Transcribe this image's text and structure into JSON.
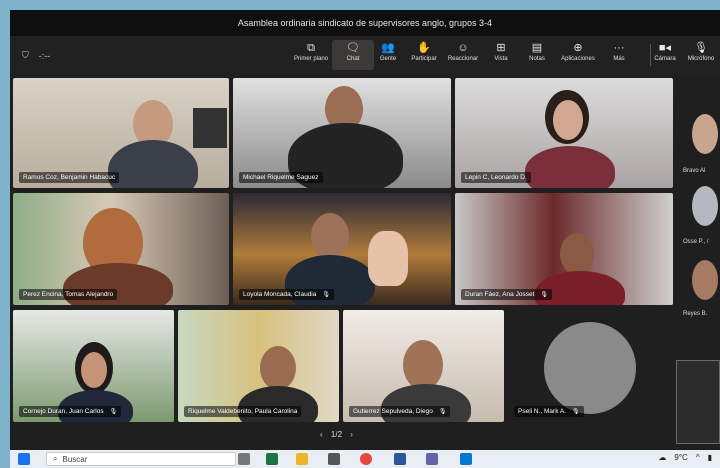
{
  "window": {
    "title": "Asamblea ordinaria sindicato de supervisores anglo, grupos 3-4"
  },
  "toolbar": {
    "timer": "-:--",
    "buttons": [
      {
        "label": "Primer plano",
        "icon": "screen-share-icon"
      },
      {
        "label": "Chat",
        "icon": "chat-icon"
      },
      {
        "label": "Gente",
        "icon": "people-icon"
      },
      {
        "label": "Participar",
        "icon": "raise-hand-icon"
      },
      {
        "label": "Reaccionar",
        "icon": "smile-icon"
      },
      {
        "label": "Vista",
        "icon": "grid-view-icon"
      },
      {
        "label": "Notas",
        "icon": "notes-icon"
      },
      {
        "label": "Aplicaciones",
        "icon": "add-app-icon"
      },
      {
        "label": "Más",
        "icon": "more-icon"
      },
      {
        "label": "Cámara",
        "icon": "camera-icon"
      },
      {
        "label": "Micrófono",
        "icon": "mic-icon"
      }
    ]
  },
  "participants": [
    {
      "name": "Ramos Coz, Benjamin Habacuc"
    },
    {
      "name": "Michael Riquelme Saguez"
    },
    {
      "name": "Lepin C, Leonardo D."
    },
    {
      "name": "Perez Encina, Tomas Alejandro"
    },
    {
      "name": "Loyola Moncada, Claudia"
    },
    {
      "name": "Duran Fáez, Ana Josset"
    },
    {
      "name": "Cornejo Duran, Juan Carlos"
    },
    {
      "name": "Riquelme Valdebenito, Paula Carolina"
    },
    {
      "name": "Gutierrez Sepulveda, Diego"
    },
    {
      "name": "Pseli N., Mark A."
    }
  ],
  "side_participants": [
    {
      "name": "Bravo Al"
    },
    {
      "name": "Osse P., /"
    },
    {
      "name": "Reyes B."
    }
  ],
  "pager": {
    "text": "1/2"
  },
  "taskbar": {
    "search_placeholder": "Buscar",
    "temperature": "9°C"
  },
  "colors": {
    "accent": "#6264a7",
    "toolbar_bg": "#212121",
    "stage_bg": "#1f1f1f"
  }
}
